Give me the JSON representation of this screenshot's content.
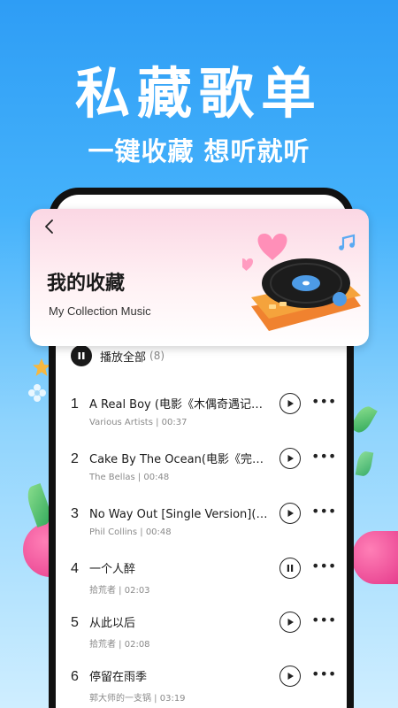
{
  "hero": {
    "title": "私藏歌单",
    "subtitle": "一键收藏 想听就听"
  },
  "card": {
    "title": "我的收藏",
    "subtitle": "My Collection Music"
  },
  "list": {
    "play_all_label": "播放全部",
    "play_all_count": "(8)",
    "songs": [
      {
        "num": "1",
        "title": "A Real Boy (电影《木偶奇遇记》…",
        "meta": "Various Artists | 00:37",
        "state": "play"
      },
      {
        "num": "2",
        "title": "Cake By The Ocean(电影《完美音…",
        "meta": "The Bellas | 00:48",
        "state": "play"
      },
      {
        "num": "3",
        "title": "No Way Out [Single Version](电影…",
        "meta": "Phil Collins | 00:48",
        "state": "play"
      },
      {
        "num": "4",
        "title": "一个人醉",
        "meta": "拾荒者 | 02:03",
        "state": "pause"
      },
      {
        "num": "5",
        "title": "从此以后",
        "meta": "拾荒者 | 02:08",
        "state": "play"
      },
      {
        "num": "6",
        "title": "停留在雨季",
        "meta": "郭大师的一支锅 | 03:19",
        "state": "play"
      }
    ]
  },
  "colors": {
    "background_top": "#2e9df5",
    "card_pink": "#fbd7e4",
    "accent_orange": "#f5a33c"
  },
  "icons": [
    "back-arrow-icon",
    "pause-icon",
    "play-icon",
    "more-icon",
    "heart-icon",
    "music-note-icon"
  ]
}
